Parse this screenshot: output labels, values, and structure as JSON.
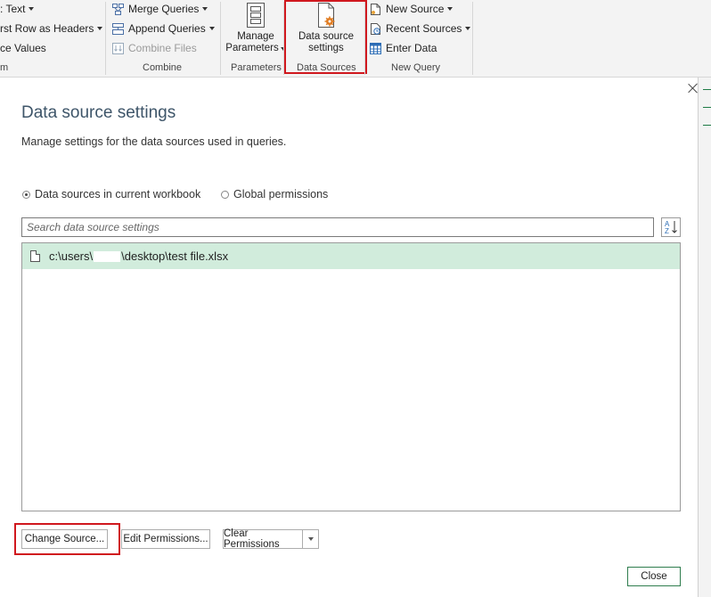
{
  "ribbon": {
    "transform_items": [
      {
        "label": ": Text",
        "has_dropdown": true
      },
      {
        "label": "rst Row as Headers",
        "has_dropdown": true
      },
      {
        "label": "ce Values",
        "has_dropdown": false
      }
    ],
    "transform_group_label": "m",
    "combine_items": [
      {
        "label": "Merge Queries",
        "icon": "merge-queries-icon",
        "has_dropdown": true
      },
      {
        "label": "Append Queries",
        "icon": "append-queries-icon",
        "has_dropdown": true
      },
      {
        "label": "Combine Files",
        "icon": "combine-files-icon",
        "disabled": true
      }
    ],
    "combine_group_label": "Combine",
    "manage_parameters": {
      "line1": "Manage",
      "line2": "Parameters",
      "icon": "parameters-icon"
    },
    "parameters_group_label": "Parameters",
    "data_source_settings": {
      "line1": "Data source",
      "line2": "settings",
      "icon": "data-source-settings-icon"
    },
    "data_sources_group_label": "Data Sources",
    "new_query_items": [
      {
        "label": "New Source",
        "icon": "new-source-icon",
        "has_dropdown": true
      },
      {
        "label": "Recent Sources",
        "icon": "recent-sources-icon",
        "has_dropdown": true
      },
      {
        "label": "Enter Data",
        "icon": "enter-data-icon"
      }
    ],
    "new_query_group_label": "New Query"
  },
  "dialog": {
    "title": "Data source settings",
    "subtitle": "Manage settings for the data sources used in queries.",
    "radio_current": "Data sources in current workbook",
    "radio_global": "Global permissions",
    "selected_scope": "current",
    "search_placeholder": "Search data source settings",
    "sources": [
      {
        "path_prefix": "c:\\users\\",
        "path_suffix": "\\desktop\\test file.xlsx",
        "selected": true
      }
    ],
    "buttons": {
      "change_source": "Change Source...",
      "edit_permissions": "Edit Permissions...",
      "clear_permissions": "Clear Permissions",
      "close": "Close"
    }
  },
  "colors": {
    "highlight_red": "#d0181e",
    "selected_row": "#d1ecdc",
    "title_color": "#3e5569",
    "accent_orange": "#e07a1f"
  }
}
